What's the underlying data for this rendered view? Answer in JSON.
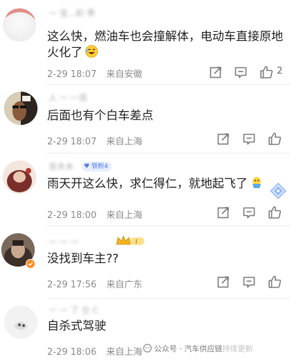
{
  "comments": [
    {
      "username": "一 宝...彩 靑",
      "text": "这么快，燃油车也会撞解体，电动车直接原地",
      "text_line2": "火化了",
      "date": "2-29 18:07",
      "location": "来自安徽",
      "like_count": "2"
    },
    {
      "username": "人 一 一百",
      "text": "后面也有个白车差点",
      "date": "2-29 18:07",
      "location": "来自上海"
    },
    {
      "username": "吉木木",
      "fan_badge": "铁粉4",
      "text": "雨天开这么快，求仁得仁，就地起飞了",
      "date": "2-29 18:00",
      "location": "来自上海"
    },
    {
      "username": "一 一 一",
      "text": "没找到车主??",
      "date": "2-29 17:56",
      "location": "来自广东"
    },
    {
      "username": "一 一 了 仝 C",
      "text": "自杀式驾驶",
      "date": "2-29 18:06",
      "location": "来自上海"
    }
  ],
  "watermark": {
    "label": "公众号 · 汽车供应链",
    "faded": "持续更新"
  },
  "colors": {
    "text": "#1f1f1f",
    "meta": "#8a8a8a",
    "icon": "#7a7a7a",
    "badge": "#4f79ef"
  }
}
